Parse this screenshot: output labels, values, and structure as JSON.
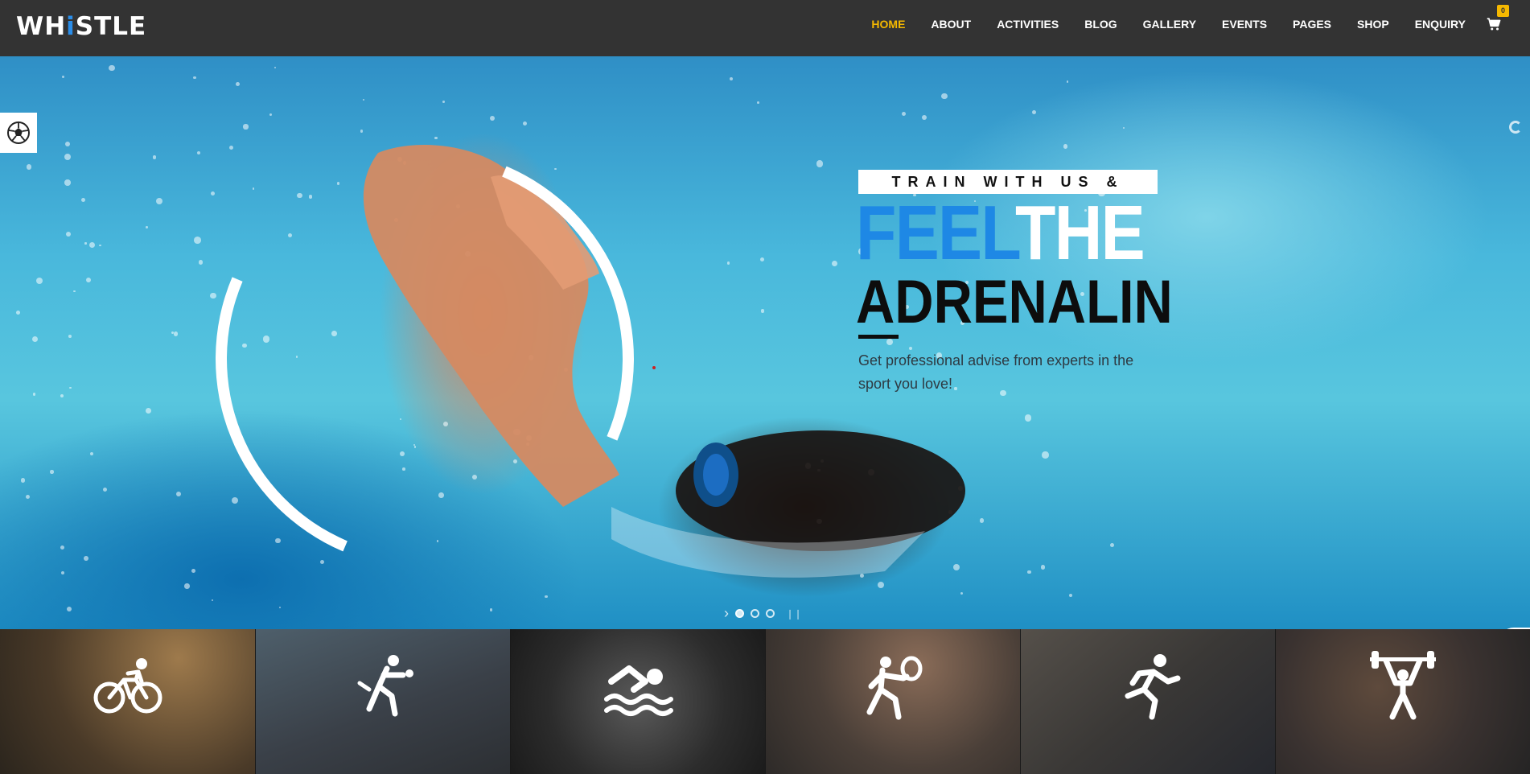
{
  "header": {
    "logo": {
      "prefix": "WH",
      "accent": "i",
      "suffix": "STLE"
    },
    "nav": [
      {
        "label": "HOME",
        "active": true
      },
      {
        "label": "ABOUT",
        "active": false
      },
      {
        "label": "ACTIVITIES",
        "active": false
      },
      {
        "label": "BLOG",
        "active": false
      },
      {
        "label": "GALLERY",
        "active": false
      },
      {
        "label": "EVENTS",
        "active": false
      },
      {
        "label": "PAGES",
        "active": false
      },
      {
        "label": "SHOP",
        "active": false
      },
      {
        "label": "ENQUIRY",
        "active": false
      }
    ],
    "cart_count": "0"
  },
  "hero": {
    "tagline": "TRAIN WITH US &",
    "headline_blue": "FEEL",
    "headline_white": "THE",
    "headline_dark": "ADRENALIN",
    "subtext": "Get professional advise from experts in the sport you love!",
    "slider": {
      "total_slides": 3,
      "active_slide": 1
    }
  },
  "activities": [
    {
      "icon": "cycling-icon"
    },
    {
      "icon": "golf-swing-icon"
    },
    {
      "icon": "swimming-icon"
    },
    {
      "icon": "tennis-icon"
    },
    {
      "icon": "running-icon"
    },
    {
      "icon": "weightlifting-icon"
    }
  ],
  "colors": {
    "header_bg": "#333333",
    "nav_active": "#f5b800",
    "brand_blue": "#1e88e5",
    "cart_badge": "#f5b800"
  }
}
